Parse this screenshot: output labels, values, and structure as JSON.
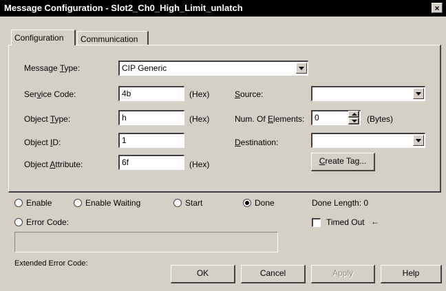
{
  "window": {
    "title": "Message Configuration - Slot2_Ch0_High_Limit_unlatch",
    "close_glyph": "×"
  },
  "tabs": [
    {
      "label": "Configuration"
    },
    {
      "label": "Communication"
    }
  ],
  "config": {
    "message_type": {
      "label_pre": "Message ",
      "label_u": "T",
      "label_post": "ype:",
      "value": "CIP Generic"
    },
    "service_code": {
      "label_pre": "Ser",
      "label_u": "v",
      "label_post": "ice Code:",
      "value": "4b",
      "unit": "(Hex)"
    },
    "object_type": {
      "label_pre": "Object ",
      "label_u": "T",
      "label_post": "ype:",
      "value": "h",
      "unit": "(Hex)"
    },
    "object_id": {
      "label_pre": "Object ",
      "label_u": "I",
      "label_post": "D:",
      "value": "1"
    },
    "object_attribute": {
      "label_pre": "Object ",
      "label_u": "A",
      "label_post": "ttribute:",
      "value": "6f",
      "unit": "(Hex)"
    },
    "source": {
      "label_pre": "",
      "label_u": "S",
      "label_post": "ource:",
      "value": ""
    },
    "num_elements": {
      "label_pre": "Num. Of ",
      "label_u": "E",
      "label_post": "lements:",
      "value": "0",
      "unit": "(Bytes)"
    },
    "destination": {
      "label_pre": "",
      "label_u": "D",
      "label_post": "estination:",
      "value": ""
    },
    "create_tag": {
      "label_pre": "",
      "label_u": "C",
      "label_post": "reate Tag..."
    }
  },
  "status": {
    "enable": "Enable",
    "enable_waiting": "Enable Waiting",
    "start": "Start",
    "done": "Done",
    "done_length": "Done Length: 0",
    "error_code": "Error Code:",
    "timed_out": "Timed Out",
    "timed_out_arrow": "←",
    "extended_error_code": "Extended Error Code:"
  },
  "buttons": {
    "ok": "OK",
    "cancel": "Cancel",
    "apply": "Apply",
    "help": "Help"
  }
}
